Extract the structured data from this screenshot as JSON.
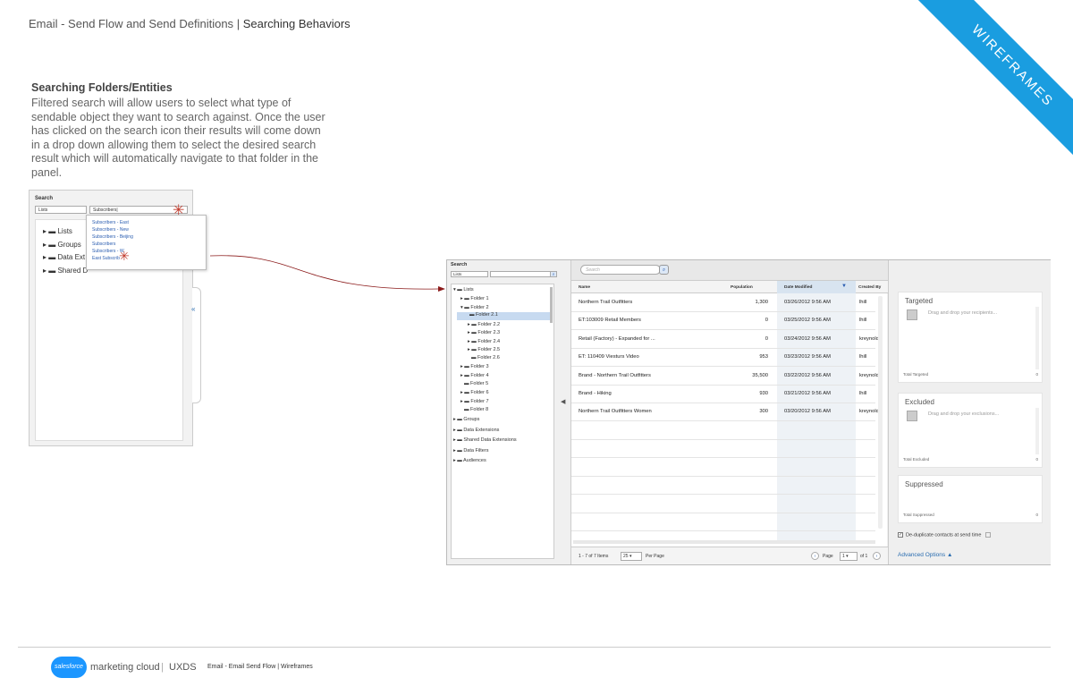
{
  "header": {
    "left": "Email - Send Flow and Send Definitions",
    "sep": "|",
    "right": "Searching Behaviors"
  },
  "ribbon": "WIREFRAMES",
  "description": {
    "title": "Searching Folders/Entities",
    "body": "Filtered search will allow users to select what type of sendable object they want to search against. Once the user has clicked on the search icon their results will come down in a drop down allowing them to select the desired search result which will automatically navigate to that folder in the panel."
  },
  "small_panel": {
    "label": "Search",
    "select_value": "Lists",
    "input_value": "Subscribers|",
    "tree": [
      "Lists",
      "Groups",
      "Data Ext",
      "Shared D"
    ],
    "dropdown": [
      "Subscribers - East",
      "Subscribers - New",
      "Subscribers - Beijing",
      "Subscribers",
      "Subscribers - W",
      "East Subscrib"
    ],
    "collapse_glyph": "«"
  },
  "big_panel": {
    "search_label": "Search",
    "select_value": "Lists",
    "tree": [
      {
        "label": "Lists"
      },
      {
        "label": "Folder 1"
      },
      {
        "label": "Folder 2"
      },
      {
        "label": "Folder 2.1"
      },
      {
        "label": "Folder 2.2"
      },
      {
        "label": "Folder 2.3"
      },
      {
        "label": "Folder 2.4"
      },
      {
        "label": "Folder 2.5"
      },
      {
        "label": "Folder 2.6"
      },
      {
        "label": "Folder 3"
      },
      {
        "label": "Folder 4"
      },
      {
        "label": "Folder 5"
      },
      {
        "label": "Folder 6"
      },
      {
        "label": "Folder 7"
      },
      {
        "label": "Folder 8"
      },
      {
        "label": "Groups"
      },
      {
        "label": "Data Extensions"
      },
      {
        "label": "Shared Data Extensions"
      },
      {
        "label": "Data Filters"
      },
      {
        "label": "Audiences"
      }
    ],
    "grid_search_placeholder": "Search",
    "columns": [
      "Name",
      "Population",
      "Date Modified",
      "Created By"
    ],
    "rows": [
      [
        "Northern Trail Outfitters",
        "1,300",
        "03/26/2012 9:56 AM",
        "lhill"
      ],
      [
        "ET:103009 Retail Members",
        "0",
        "03/25/2012 9:56 AM",
        "lhill"
      ],
      [
        "Retail (Factory) - Expanded for ...",
        "0",
        "03/24/2012 9:56 AM",
        "kreynolds"
      ],
      [
        "ET: 110409 Viesturs Video",
        "953",
        "03/23/2012 9:56 AM",
        "lhill"
      ],
      [
        "Brand - Northern Trail Outfitters",
        "35,500",
        "03/22/2012 9:56 AM",
        "kreynolds"
      ],
      [
        "Brand - Hiking",
        "930",
        "03/21/2012 9:56 AM",
        "lhill"
      ],
      [
        "Northern Trail Outfitters Women",
        "300",
        "03/20/2012 9:56 AM",
        "kreynolds"
      ]
    ],
    "footer": {
      "items": "1 - 7 of 7 Items",
      "per_page_value": "25",
      "per_page_label": "Per Page",
      "page_label": "Page",
      "page_value": "1",
      "of_label": "of 1"
    },
    "cards": [
      {
        "title": "Targeted",
        "drop": "Drag and drop your recipients...",
        "total_label": "Total Targeted",
        "total": "0"
      },
      {
        "title": "Excluded",
        "drop": "Drag and drop your exclusions...",
        "total_label": "Total Excluded",
        "total": "0"
      },
      {
        "title": "Suppressed",
        "drop": "",
        "total_label": "Total Suppressed",
        "total": "0"
      }
    ],
    "dedupe": "De-duplicate contacts at send time",
    "advanced": "Advanced Options"
  },
  "footer": {
    "logo": "salesforce",
    "brand": "marketing cloud",
    "sep": "|",
    "uxds": "UXDS",
    "small": "Email - Email Send Flow  |  Wireframes"
  },
  "colors": {
    "accent": "#1a9de0",
    "link": "#2a6db0",
    "highlight": "#c7daf0"
  }
}
